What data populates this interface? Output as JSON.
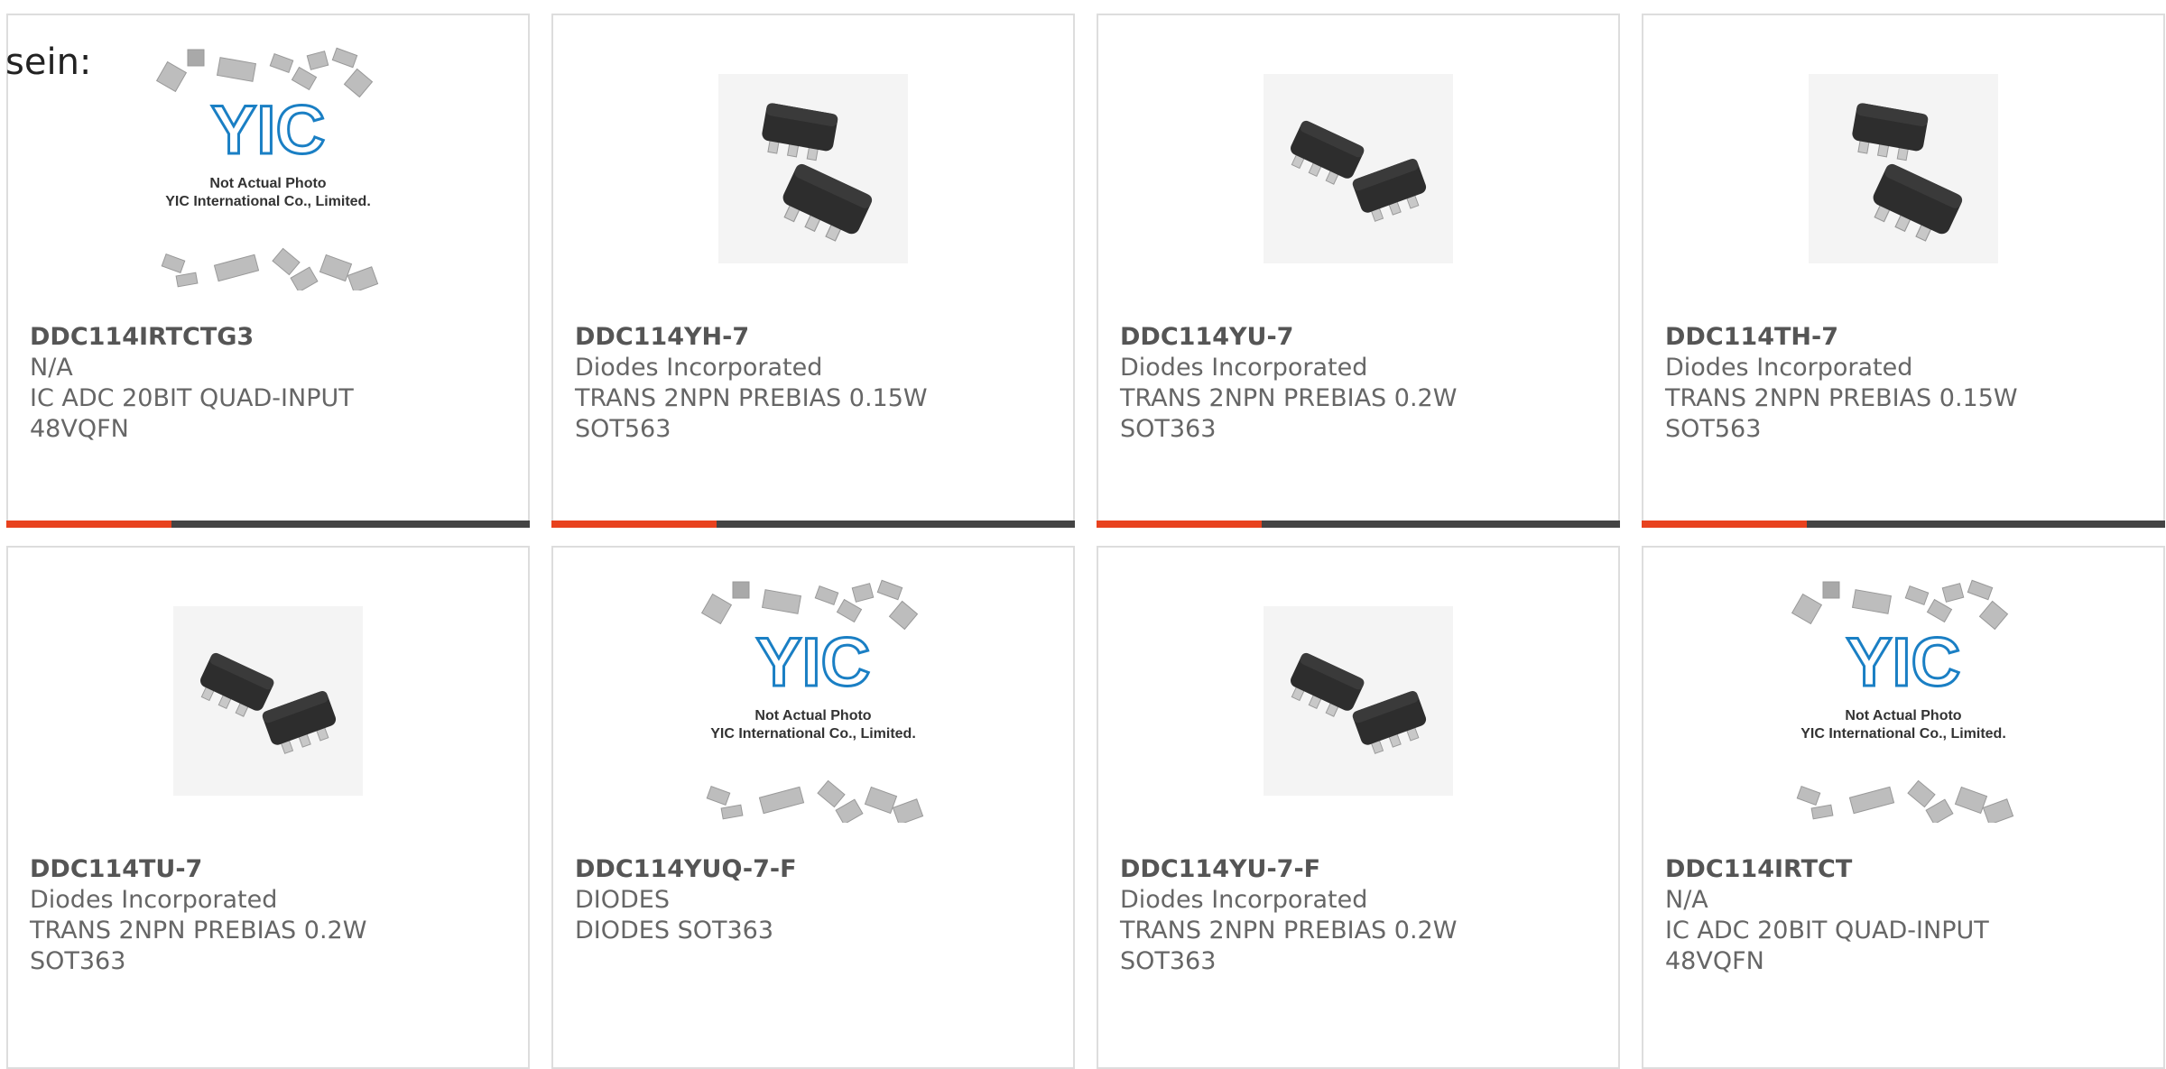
{
  "lead_text": "sein:",
  "colors": {
    "accent": "#e8421e",
    "bar": "#444444",
    "border": "#dddddd",
    "brand_blue": "#1a7fc4"
  },
  "products": [
    {
      "part": "DDC114IRTCTG3",
      "maker": "N/A",
      "desc": "IC ADC 20BIT QUAD-INPUT",
      "pkg": "48VQFN",
      "image": "not-actual-photo-placeholder"
    },
    {
      "part": "DDC114YH-7",
      "maker": "Diodes Incorporated",
      "desc": "TRANS 2NPN PREBIAS 0.15W",
      "pkg": "SOT563",
      "image": "sot563-chip-photo"
    },
    {
      "part": "DDC114YU-7",
      "maker": "Diodes Incorporated",
      "desc": "TRANS 2NPN PREBIAS 0.2W",
      "pkg": "SOT363",
      "image": "sot363-chip-photo"
    },
    {
      "part": "DDC114TH-7",
      "maker": "Diodes Incorporated",
      "desc": "TRANS 2NPN PREBIAS 0.15W",
      "pkg": "SOT563",
      "image": "sot563-chip-photo"
    },
    {
      "part": "DDC114TU-7",
      "maker": "Diodes Incorporated",
      "desc": "TRANS 2NPN PREBIAS 0.2W",
      "pkg": "SOT363",
      "image": "sot363-chip-photo"
    },
    {
      "part": "DDC114YUQ-7-F",
      "maker": "DIODES",
      "desc": "DIODES SOT363",
      "pkg": "",
      "image": "not-actual-photo-placeholder"
    },
    {
      "part": "DDC114YU-7-F",
      "maker": "Diodes Incorporated",
      "desc": "TRANS 2NPN PREBIAS 0.2W",
      "pkg": "SOT363",
      "image": "sot363-chip-photo"
    },
    {
      "part": "DDC114IRTCT",
      "maker": "N/A",
      "desc": "IC ADC 20BIT QUAD-INPUT",
      "pkg": "48VQFN",
      "image": "not-actual-photo-placeholder"
    }
  ],
  "placeholder": {
    "logo_text": "YIC",
    "line1": "Not Actual Photo",
    "line2": "YIC International Co., Limited."
  }
}
